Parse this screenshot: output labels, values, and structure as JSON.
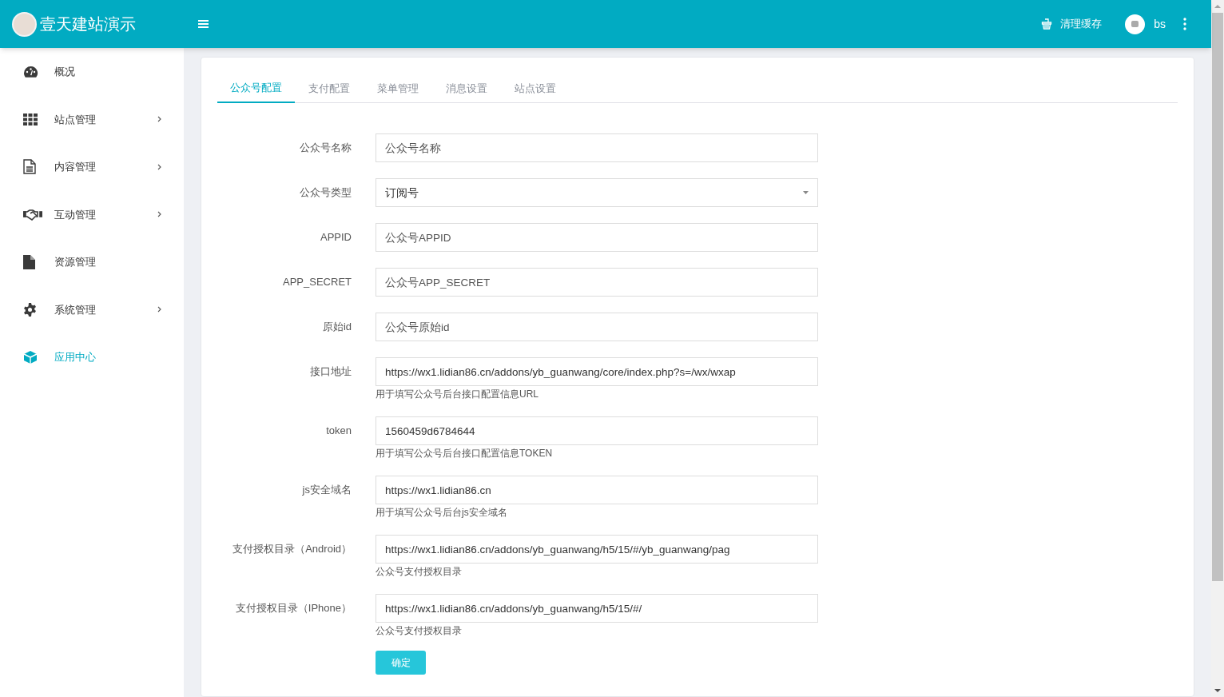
{
  "header": {
    "brand": "壹天建站演示",
    "clear_cache": "清理缓存",
    "user": "bs"
  },
  "sidebar": {
    "items": [
      {
        "label": "概况",
        "has_arrow": false,
        "selected": false
      },
      {
        "label": "站点管理",
        "has_arrow": true,
        "selected": false
      },
      {
        "label": "内容管理",
        "has_arrow": true,
        "selected": false
      },
      {
        "label": "互动管理",
        "has_arrow": true,
        "selected": false
      },
      {
        "label": "资源管理",
        "has_arrow": false,
        "selected": false
      },
      {
        "label": "系统管理",
        "has_arrow": true,
        "selected": false
      },
      {
        "label": "应用中心",
        "has_arrow": false,
        "selected": true
      }
    ]
  },
  "tabs": [
    {
      "label": "公众号配置",
      "selected": true
    },
    {
      "label": "支付配置",
      "selected": false
    },
    {
      "label": "菜单管理",
      "selected": false
    },
    {
      "label": "消息设置",
      "selected": false
    },
    {
      "label": "站点设置",
      "selected": false
    }
  ],
  "form": {
    "fields": [
      {
        "kind": "text",
        "label": "公众号名称",
        "placeholder": "公众号名称"
      },
      {
        "kind": "select",
        "label": "公众号类型",
        "value": "订阅号"
      },
      {
        "kind": "text",
        "label": "APPID",
        "placeholder": "公众号APPID"
      },
      {
        "kind": "text",
        "label": "APP_SECRET",
        "placeholder": "公众号APP_SECRET"
      },
      {
        "kind": "text",
        "label": "原始id",
        "placeholder": "公众号原始id"
      },
      {
        "kind": "text",
        "label": "接口地址",
        "value": "https://wx1.lidian86.cn/addons/yb_guanwang/core/index.php?s=/wx/wxap",
        "help": "用于填写公众号后台接口配置信息URL"
      },
      {
        "kind": "text",
        "label": "token",
        "value": "1560459d6784644",
        "help": "用于填写公众号后台接口配置信息TOKEN"
      },
      {
        "kind": "text",
        "label": "js安全域名",
        "value": "https://wx1.lidian86.cn",
        "help": "用于填写公众号后台js安全域名"
      },
      {
        "kind": "text",
        "label": "支付授权目录（Android）",
        "value": "https://wx1.lidian86.cn/addons/yb_guanwang/h5/15/#/yb_guanwang/pag",
        "help": "公众号支付授权目录"
      },
      {
        "kind": "text",
        "label": "支付授权目录（IPhone）",
        "value": "https://wx1.lidian86.cn/addons/yb_guanwang/h5/15/#/",
        "help": "公众号支付授权目录"
      }
    ],
    "submit": "确定"
  }
}
